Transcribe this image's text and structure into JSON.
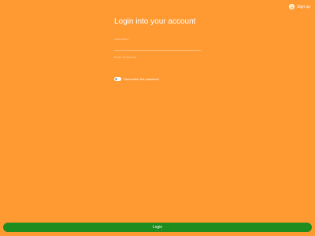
{
  "header": {
    "signup_label": "Sign up",
    "signup_icon": "avatar-icon"
  },
  "form": {
    "title": "Login into your account",
    "username_placeholder": "Username",
    "password_placeholder": "Enter Password",
    "remember_label": "Remember the password",
    "remember_enabled": false
  },
  "footer": {
    "login_label": "Login"
  },
  "colors": {
    "background": "#ff9a33",
    "login_button": "#1e8c1e",
    "text": "#ffffff"
  }
}
